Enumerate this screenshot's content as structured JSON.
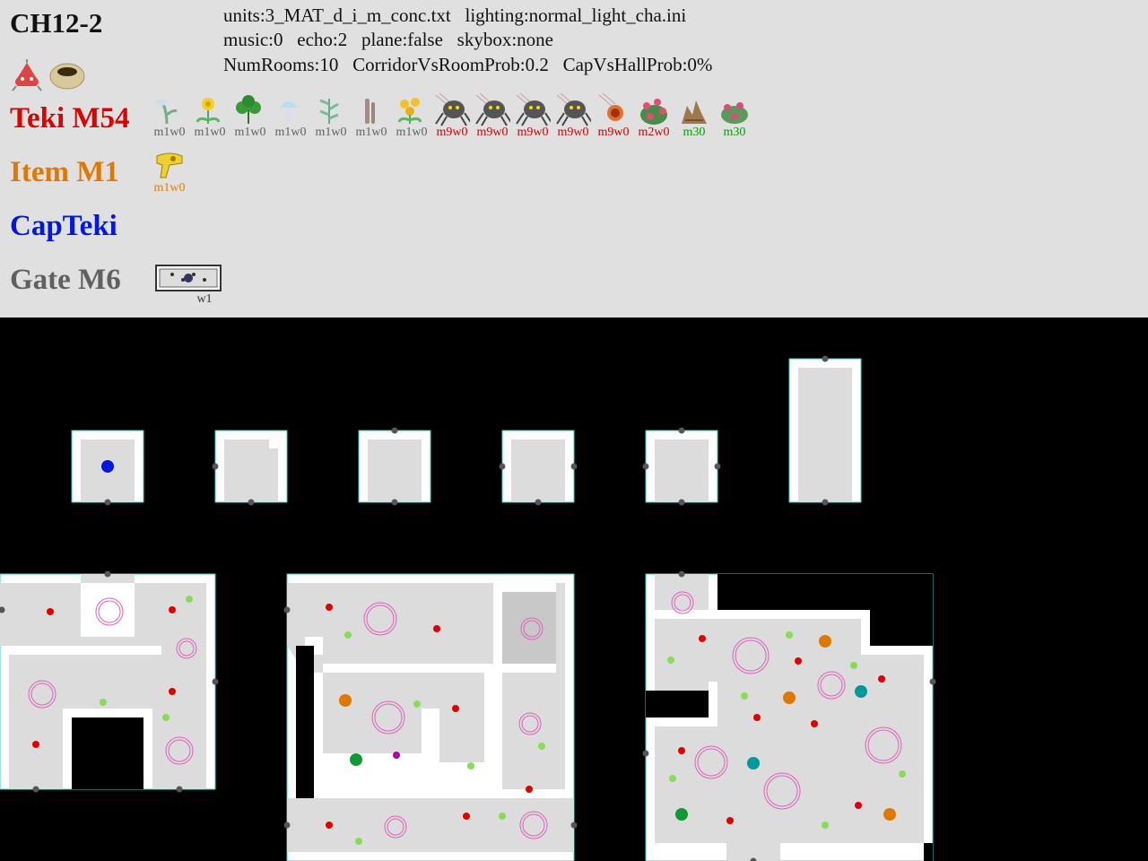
{
  "sublevel": "CH12-2",
  "info": {
    "line1": "units:3_MAT_d_i_m_conc.txt   lighting:normal_light_cha.ini",
    "line2": "music:0   echo:2   plane:false   skybox:none",
    "line3": "NumRooms:10   CorridorVsRoomProb:0.2   CapVsHallProb:0%"
  },
  "colors": {
    "teki": "#dd0000",
    "item": "#e07800",
    "capteki": "#0018e0",
    "gate": "#606060",
    "enemy_label": "#cc0000",
    "plant_label": "#606060",
    "treasure_label": "#e08000",
    "m30_label": "#00a000",
    "room_floor": "#dcdcdc",
    "room_border": "#ffffff",
    "room_outline": "#33cccc",
    "spawn_red": "#e00000",
    "spawn_green": "#88dd55",
    "spawn_orange": "#e07800",
    "spawn_teal": "#009999",
    "spawn_darkgreen": "#119933",
    "spawn_purple": "#aa00aa",
    "start_blue": "#0018e0",
    "ring_pink": "#e060c0"
  },
  "rows": {
    "teki": "Teki M54",
    "item": "Item M1",
    "capteki": "CapTeki",
    "gate": "Gate M6"
  },
  "teki_entries": [
    {
      "icon": "sprout-plant-icon",
      "label": "m1w0",
      "kind": "plant"
    },
    {
      "icon": "dandelion-plant-icon",
      "label": "m1w0",
      "kind": "plant"
    },
    {
      "icon": "clover-plant-icon",
      "label": "m1w0",
      "kind": "plant"
    },
    {
      "icon": "mushroom-plant-icon",
      "label": "m1w0",
      "kind": "plant"
    },
    {
      "icon": "fern-plant-icon",
      "label": "m1w0",
      "kind": "plant"
    },
    {
      "icon": "stalk-plant-icon",
      "label": "m1w0",
      "kind": "plant"
    },
    {
      "icon": "yellow-flower-plant-icon",
      "label": "m1w0",
      "kind": "plant"
    },
    {
      "icon": "spider-enemy-icon",
      "label": "m9w0",
      "kind": "enemy"
    },
    {
      "icon": "spider-enemy-icon",
      "label": "m9w0",
      "kind": "enemy"
    },
    {
      "icon": "spider-enemy-icon",
      "label": "m9w0",
      "kind": "enemy"
    },
    {
      "icon": "spider-enemy-icon",
      "label": "m9w0",
      "kind": "enemy"
    },
    {
      "icon": "bomb-rock-icon",
      "label": "m9w0",
      "kind": "enemy"
    },
    {
      "icon": "flower-bush-icon",
      "label": "m2w0",
      "kind": "enemy"
    },
    {
      "icon": "brown-bush-icon",
      "label": "m30",
      "kind": "m30"
    },
    {
      "icon": "berry-bush-icon",
      "label": "m30",
      "kind": "m30"
    }
  ],
  "item_entries": [
    {
      "icon": "golden-key-treasure-icon",
      "label": "m1w0"
    }
  ],
  "gate_entries": [
    {
      "icon": "gate-icon",
      "label": "w1"
    }
  ],
  "header_icons": [
    "pikmin-onion-icon",
    "cave-hole-icon"
  ]
}
